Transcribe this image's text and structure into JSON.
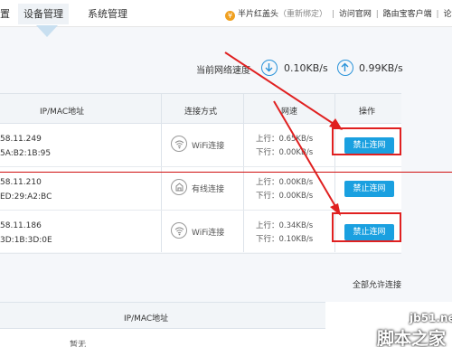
{
  "nav": {
    "partial_item": "置",
    "items": [
      {
        "label": "设备管理",
        "active": true
      },
      {
        "label": "系统管理",
        "active": false
      }
    ],
    "user": {
      "coin_glyph": "¥",
      "name": "半片红盖头",
      "status": "（重新绑定）",
      "links": [
        "访问官网",
        "路由宝客户端",
        "论坛"
      ],
      "separator": "|"
    }
  },
  "speed": {
    "label": "当前网络速度",
    "download": "0.10KB/s",
    "upload": "0.99KB/s"
  },
  "table": {
    "headers": {
      "ipmac": "IP/MAC地址",
      "connection": "连接方式",
      "speed": "网速",
      "action": "操作"
    },
    "rows": [
      {
        "ip": "58.11.249",
        "mac": "5A:B2:1B:95",
        "conn_type": "WiFi连接",
        "conn_icon": "wifi-icon",
        "up": "上行：0.65KB/s",
        "down": "下行：0.00KB/s",
        "action": "禁止连网",
        "highlighted": true
      },
      {
        "ip": "58.11.210",
        "mac": "ED:29:A2:BC",
        "conn_type": "有线连接",
        "conn_icon": "wired-icon",
        "up": "上行：0.00KB/s",
        "down": "下行：0.00KB/s",
        "action": "禁止连网",
        "highlighted": false
      },
      {
        "ip": "58.11.186",
        "mac": "3D:1B:3D:0E",
        "conn_type": "WiFi连接",
        "conn_icon": "wifi-icon",
        "up": "上行：0.34KB/s",
        "down": "下行：0.10KB/s",
        "action": "禁止连网",
        "highlighted": true
      }
    ]
  },
  "allow_all_label": "全部允许连接",
  "blocked_table": {
    "header": "IP/MAC地址",
    "empty_text": "暂无"
  },
  "watermark": {
    "url": "jb51.net",
    "text": "脚本之家"
  },
  "colors": {
    "accent": "#1aa0e0",
    "annotation": "#e02020"
  }
}
